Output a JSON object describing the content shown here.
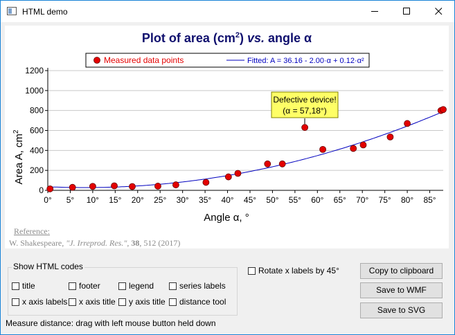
{
  "window": {
    "title": "HTML demo",
    "accent": "#1883d7"
  },
  "chart_data": {
    "type": "scatter",
    "title_pre": "Plot of area (cm",
    "title_sup": "2",
    "title_mid": ") ",
    "title_vs": "vs.",
    "title_post": " angle α",
    "xlabel": "Angle α, °",
    "ylabel": "Area A, cm",
    "ylabel_sup": "2",
    "xlim": [
      0,
      88
    ],
    "ylim": [
      0,
      1200
    ],
    "x_ticks": [
      0,
      5,
      10,
      15,
      20,
      25,
      30,
      35,
      40,
      45,
      50,
      55,
      60,
      65,
      70,
      75,
      80,
      85
    ],
    "x_tick_labels": [
      "0°",
      "5°",
      "10°",
      "15°",
      "20°",
      "25°",
      "30°",
      "35°",
      "40°",
      "45°",
      "50°",
      "55°",
      "60°",
      "65°",
      "70°",
      "75°",
      "80°",
      "85°"
    ],
    "y_ticks": [
      0,
      200,
      400,
      600,
      800,
      1000,
      1200
    ],
    "y_tick_labels": [
      "0",
      "200",
      "400",
      "600",
      "800",
      "1000",
      "1200"
    ],
    "grid": "horizontal",
    "legend_position": "top",
    "series": [
      {
        "name": "Measured data points",
        "kind": "points",
        "color": "#e30000",
        "x": [
          0.5,
          5.5,
          10,
          14.8,
          18.8,
          24.5,
          28.5,
          35.2,
          40.2,
          42.3,
          48.9,
          52.2,
          57.2,
          61.2,
          68,
          70.2,
          76.2,
          80,
          87.5,
          88
        ],
        "y": [
          15,
          30,
          40,
          45,
          38,
          42,
          55,
          80,
          135,
          170,
          265,
          265,
          630,
          410,
          420,
          455,
          535,
          670,
          800,
          810
        ]
      },
      {
        "name": "Fitted: A = 36.16 - 2.00·α + 0.12·α²",
        "kind": "line",
        "color": "#0000bf",
        "a0": 36.16,
        "a1": -2.0,
        "a2": 0.12
      }
    ],
    "annotation": {
      "line1": "Defective device!",
      "line2": "(α = 57,18°)",
      "x": 57.18,
      "y": 630,
      "fill": "#ffff66"
    }
  },
  "reference": {
    "label": "Reference:",
    "author": "W. Shakespeare, ",
    "journal": "\"J. Irreprod. Res.\"",
    "comma": ", ",
    "volume": "38",
    "rest": ", 512 (2017)"
  },
  "options": {
    "group_title": "Show HTML codes",
    "checkboxes": [
      {
        "label": "title",
        "checked": false
      },
      {
        "label": "footer",
        "checked": false
      },
      {
        "label": "legend",
        "checked": false
      },
      {
        "label": "series labels",
        "checked": false
      },
      {
        "label": "x axis labels",
        "checked": false
      },
      {
        "label": "x axis title",
        "checked": false
      },
      {
        "label": "y axis title",
        "checked": false
      },
      {
        "label": "distance tool",
        "checked": false
      }
    ],
    "rotate_label": "Rotate x labels by 45°"
  },
  "buttons": {
    "copy": "Copy to clipboard",
    "wmf": "Save to WMF",
    "svg": "Save to SVG"
  },
  "status": "Measure distance: drag with left mouse button held down"
}
